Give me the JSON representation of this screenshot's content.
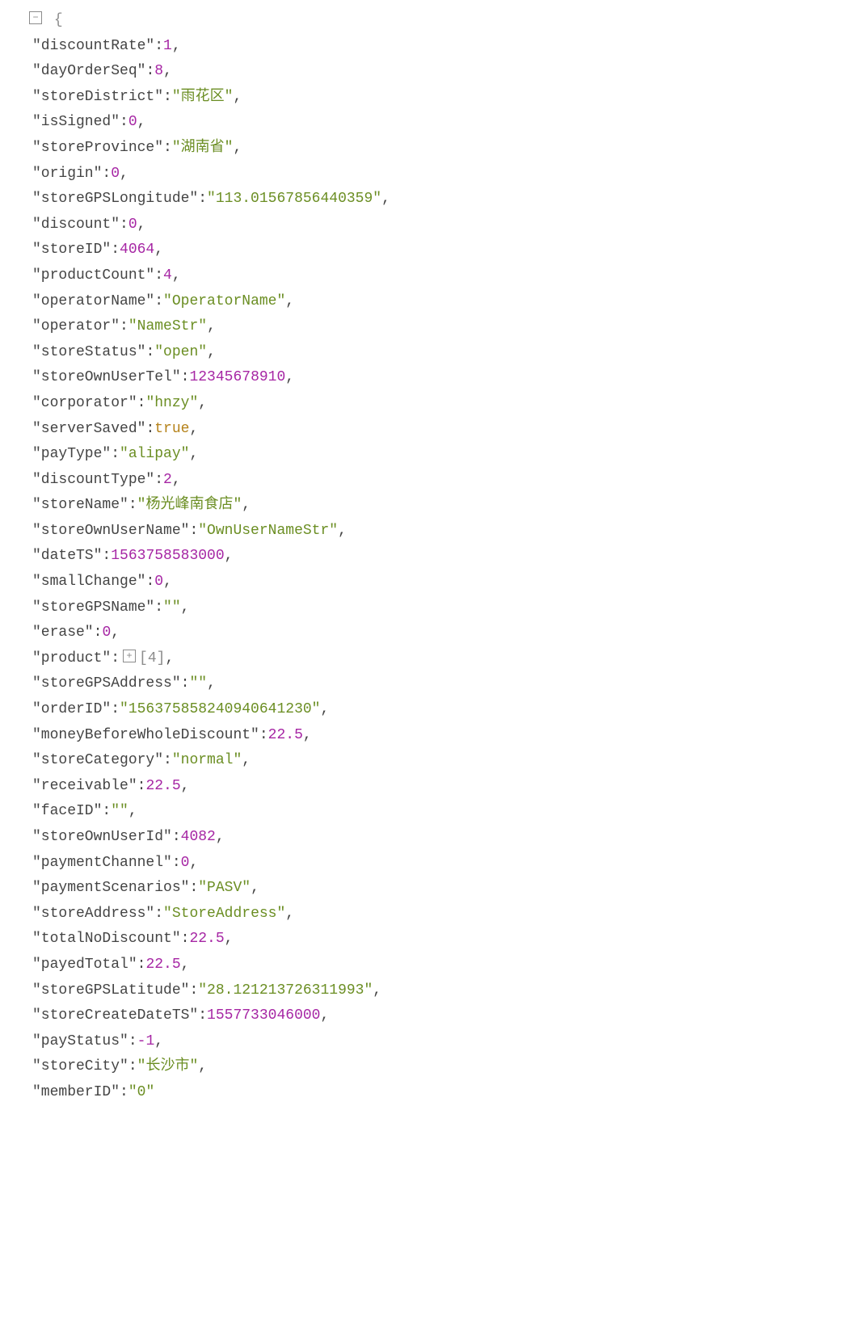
{
  "rootBrace": "{",
  "productSummary": "[4]",
  "entries": [
    {
      "k": "discountRate",
      "t": "num",
      "v": "1"
    },
    {
      "k": "dayOrderSeq",
      "t": "num",
      "v": "8"
    },
    {
      "k": "storeDistrict",
      "t": "str",
      "v": "\"雨花区\""
    },
    {
      "k": "isSigned",
      "t": "num",
      "v": "0"
    },
    {
      "k": "storeProvince",
      "t": "str",
      "v": "\"湖南省\""
    },
    {
      "k": "origin",
      "t": "num",
      "v": "0"
    },
    {
      "k": "storeGPSLongitude",
      "t": "str",
      "v": "\"113.01567856440359\""
    },
    {
      "k": "discount",
      "t": "num",
      "v": "0"
    },
    {
      "k": "storeID",
      "t": "num",
      "v": "4064"
    },
    {
      "k": "productCount",
      "t": "num",
      "v": "4"
    },
    {
      "k": "operatorName",
      "t": "str",
      "v": "\"OperatorName\""
    },
    {
      "k": "operator",
      "t": "str",
      "v": "\"NameStr\""
    },
    {
      "k": "storeStatus",
      "t": "str",
      "v": "\"open\""
    },
    {
      "k": "storeOwnUserTel",
      "t": "num",
      "v": "12345678910"
    },
    {
      "k": "corporator",
      "t": "str",
      "v": "\"hnzy\""
    },
    {
      "k": "serverSaved",
      "t": "bool",
      "v": "true"
    },
    {
      "k": "payType",
      "t": "str",
      "v": "\"alipay\""
    },
    {
      "k": "discountType",
      "t": "num",
      "v": "2"
    },
    {
      "k": "storeName",
      "t": "str",
      "v": "\"杨光峰南食店\""
    },
    {
      "k": "storeOwnUserName",
      "t": "str",
      "v": "\"OwnUserNameStr\""
    },
    {
      "k": "dateTS",
      "t": "num",
      "v": "1563758583000"
    },
    {
      "k": "smallChange",
      "t": "num",
      "v": "0"
    },
    {
      "k": "storeGPSName",
      "t": "str",
      "v": "\"\""
    },
    {
      "k": "erase",
      "t": "num",
      "v": "0"
    },
    {
      "k": "product",
      "t": "obj",
      "v": "[4]"
    },
    {
      "k": "storeGPSAddress",
      "t": "str",
      "v": "\"\""
    },
    {
      "k": "orderID",
      "t": "str",
      "v": "\"156375858240940641230\""
    },
    {
      "k": "moneyBeforeWholeDiscount",
      "t": "num",
      "v": "22.5"
    },
    {
      "k": "storeCategory",
      "t": "str",
      "v": "\"normal\""
    },
    {
      "k": "receivable",
      "t": "num",
      "v": "22.5"
    },
    {
      "k": "faceID",
      "t": "str",
      "v": "\"\""
    },
    {
      "k": "storeOwnUserId",
      "t": "num",
      "v": "4082"
    },
    {
      "k": "paymentChannel",
      "t": "num",
      "v": "0"
    },
    {
      "k": "paymentScenarios",
      "t": "str",
      "v": "\"PASV\""
    },
    {
      "k": "storeAddress",
      "t": "str",
      "v": "\"StoreAddress\""
    },
    {
      "k": "totalNoDiscount",
      "t": "num",
      "v": "22.5"
    },
    {
      "k": "payedTotal",
      "t": "num",
      "v": "22.5"
    },
    {
      "k": "storeGPSLatitude",
      "t": "str",
      "v": "\"28.121213726311993\""
    },
    {
      "k": "storeCreateDateTS",
      "t": "num",
      "v": "1557733046000"
    },
    {
      "k": "payStatus",
      "t": "num",
      "v": "-1"
    },
    {
      "k": "storeCity",
      "t": "str",
      "v": "\"长沙市\""
    },
    {
      "k": "memberID",
      "t": "str",
      "v": "\"0\"",
      "last": true
    }
  ]
}
